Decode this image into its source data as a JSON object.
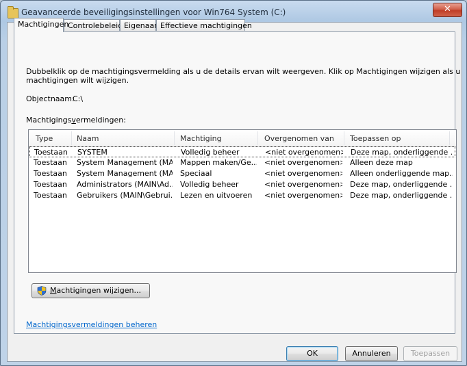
{
  "window": {
    "title": "Geavanceerde beveiligingsinstellingen voor Win764 System  (C:)",
    "close_glyph": "✕"
  },
  "tabs": [
    {
      "label": "Machtigingen",
      "active": true
    },
    {
      "label": "Controlebeleid",
      "active": false
    },
    {
      "label": "Eigenaar",
      "active": false
    },
    {
      "label": "Effectieve machtigingen",
      "active": false
    }
  ],
  "intro": {
    "line1": "Dubbelklik op de machtigingsvermelding als u de details ervan wilt weergeven. Klik op Machtigingen wijzigen als u",
    "line2": "machtigingen wilt wijzigen."
  },
  "object": {
    "label": "Objectnaam:",
    "value": "C:\\"
  },
  "entries": {
    "label_prefix": "Machtigings",
    "label_accel": "v",
    "label_suffix": "ermeldingen:",
    "columns": [
      "Type",
      "Naam",
      "Machtiging",
      "Overgenomen van",
      "Toepassen op"
    ],
    "rows": [
      {
        "type": "Toestaan",
        "name": "SYSTEM",
        "permission": "Volledig beheer",
        "inherited": "<niet overgenomen>",
        "apply": "Deze map, onderliggende ...",
        "selected": true
      },
      {
        "type": "Toestaan",
        "name": "System Management (MA...",
        "permission": "Mappen maken/Ge...",
        "inherited": "<niet overgenomen>",
        "apply": "Alleen deze map",
        "selected": false
      },
      {
        "type": "Toestaan",
        "name": "System Management (MA...",
        "permission": "Speciaal",
        "inherited": "<niet overgenomen>",
        "apply": "Alleen onderliggende map...",
        "selected": false
      },
      {
        "type": "Toestaan",
        "name": "Administrators (MAIN\\Ad...",
        "permission": "Volledig beheer",
        "inherited": "<niet overgenomen>",
        "apply": "Deze map, onderliggende ...",
        "selected": false
      },
      {
        "type": "Toestaan",
        "name": "Gebruikers (MAIN\\Gebrui...",
        "permission": "Lezen en uitvoeren",
        "inherited": "<niet overgenomen>",
        "apply": "Deze map, onderliggende ...",
        "selected": false
      }
    ]
  },
  "change_button": {
    "accel": "M",
    "rest": "achtigingen wijzigen..."
  },
  "manage_link": "Machtigingsvermeldingen beheren",
  "footer": {
    "ok": "OK",
    "cancel": "Annuleren",
    "apply": "Toepassen"
  },
  "colors": {
    "link": "#0066cc",
    "accent_shield_blue": "#2f6fd0",
    "accent_shield_yellow": "#f2c11c",
    "close_red": "#c8452e"
  }
}
